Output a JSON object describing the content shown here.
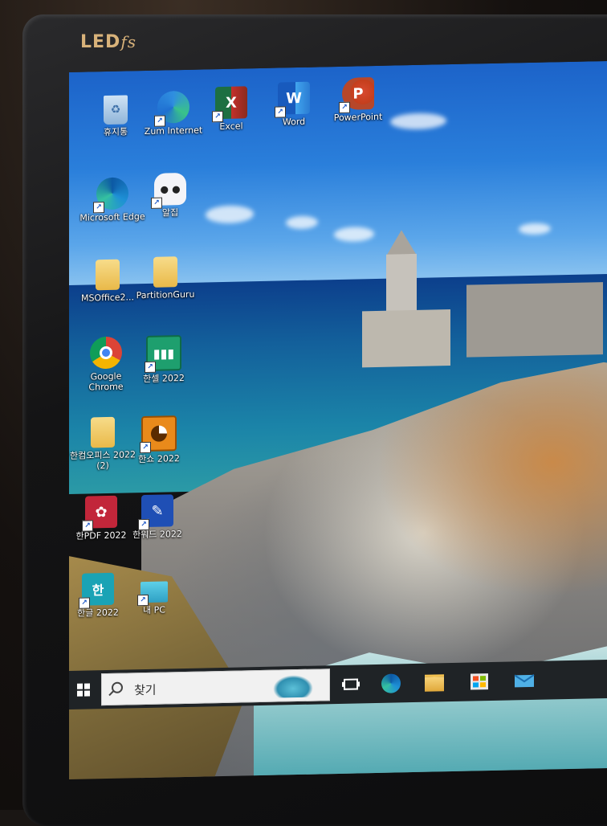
{
  "monitor": {
    "brand": "LED",
    "brand_suffix": "fs"
  },
  "desktop": {
    "icons": [
      {
        "label": "휴지통",
        "icon": "recycle-bin-icon"
      },
      {
        "label": "Zum Internet",
        "icon": "zum-internet-icon"
      },
      {
        "label": "Excel",
        "icon": "excel-icon"
      },
      {
        "label": "Word",
        "icon": "word-icon"
      },
      {
        "label": "PowerPoint",
        "icon": "powerpoint-icon"
      },
      {
        "label": "Microsoft Edge",
        "icon": "edge-icon"
      },
      {
        "label": "알집",
        "icon": "alzip-icon"
      },
      {
        "label": "MSOffice2...",
        "icon": "folder-icon"
      },
      {
        "label": "PartitionGuru",
        "icon": "folder-icon"
      },
      {
        "label": "Google Chrome",
        "icon": "chrome-icon"
      },
      {
        "label": "한셀 2022",
        "icon": "hancell-icon"
      },
      {
        "label": "한컴오피스 2022 (2)",
        "icon": "folder-icon"
      },
      {
        "label": "한쇼 2022",
        "icon": "hanshow-icon"
      },
      {
        "label": "한PDF 2022",
        "icon": "hanpdf-icon"
      },
      {
        "label": "한워드 2022",
        "icon": "hanword-icon"
      },
      {
        "label": "한글 2022",
        "icon": "hangul-icon"
      },
      {
        "label": "내 PC",
        "icon": "my-pc-icon"
      }
    ],
    "glyphs": {
      "excel": "X",
      "word": "W",
      "powerpoint": "P",
      "hangul": "한"
    }
  },
  "taskbar": {
    "search_placeholder": "찾기",
    "items": [
      "task-view-icon",
      "edge-icon",
      "file-explorer-icon",
      "store-icon",
      "mail-icon"
    ]
  }
}
